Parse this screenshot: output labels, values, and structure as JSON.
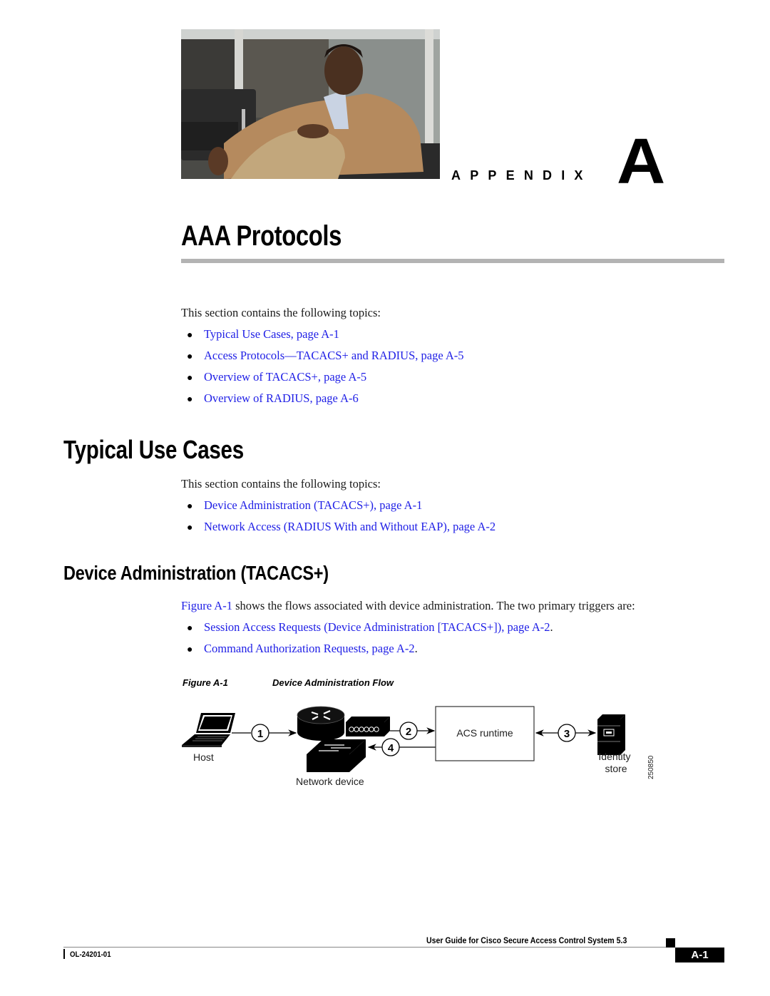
{
  "header": {
    "photo_alt": "man-seated-in-tan-jacket",
    "appendix_word": "APPENDIX",
    "appendix_letter": "A"
  },
  "chapter": {
    "title": "AAA Protocols",
    "intro": "This section contains the following topics:",
    "topics": [
      {
        "label": "Typical Use Cases, page A-1"
      },
      {
        "label": "Access Protocols—TACACS+ and RADIUS, page A-5"
      },
      {
        "label": "Overview of TACACS+, page A-5"
      },
      {
        "label": "Overview of RADIUS, page A-6"
      }
    ]
  },
  "section_typical": {
    "heading": "Typical Use Cases",
    "intro": "This section contains the following topics:",
    "topics": [
      {
        "label": "Device Administration (TACACS+), page A-1"
      },
      {
        "label": "Network Access (RADIUS With and Without EAP), page A-2"
      }
    ]
  },
  "section_device_admin": {
    "heading": "Device Administration (TACACS+)",
    "para_link": "Figure A-1",
    "para_text": " shows the flows associated with device administration. The two primary triggers are:",
    "triggers": [
      {
        "label": "Session Access Requests (Device Administration [TACACS+]), page A-2",
        "suffix": "."
      },
      {
        "label": "Command Authorization Requests, page A-2",
        "suffix": "."
      }
    ]
  },
  "figure": {
    "number": "Figure A-1",
    "title": "Device Administration Flow",
    "labels": {
      "host": "Host",
      "network_device": "Network device",
      "acs_runtime": "ACS runtime",
      "identity_store_line1": "Identity",
      "identity_store_line2": "store",
      "figure_id": "250850"
    },
    "steps": [
      "1",
      "2",
      "3",
      "4"
    ]
  },
  "footer": {
    "guide_title": "User Guide for Cisco Secure Access Control System 5.3",
    "doc_number": "OL-24201-01",
    "page": "A-1"
  }
}
